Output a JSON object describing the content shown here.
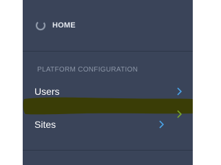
{
  "colors": {
    "sidebar_bg": "#3a4459",
    "text_primary": "#ffffff",
    "heading_text": "#8d97a8",
    "chevron": "#4aa3e6",
    "highlight_mark": "#3a3d06"
  },
  "nav": {
    "home": {
      "label": "HOME",
      "icon": "home-spinner-icon"
    },
    "section_heading": "PLATFORM CONFIGURATION",
    "items": [
      {
        "label": "Users",
        "icon": "chevron-right-icon"
      },
      {
        "label": "Sites",
        "icon": "chevron-right-icon"
      }
    ]
  }
}
